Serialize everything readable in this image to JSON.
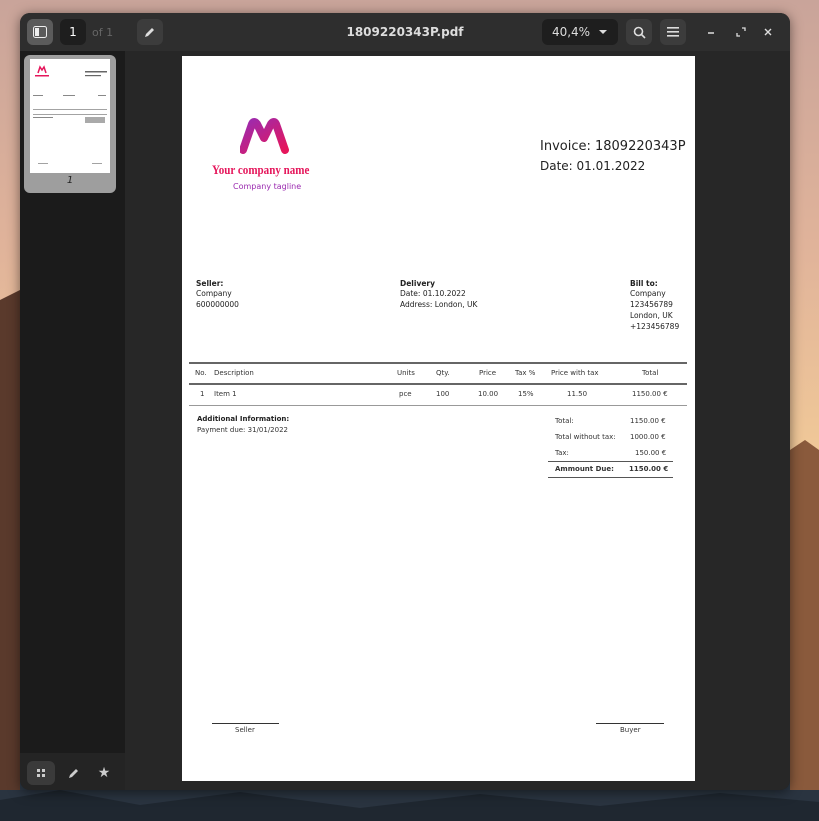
{
  "app": {
    "document_title": "1809220343P.pdf",
    "current_page": "1",
    "page_count_label": "of 1",
    "zoom": "40,4%",
    "thumbnail_page_label": "1"
  },
  "invoice": {
    "company_name": "Your company name",
    "company_tagline": "Company tagline",
    "invoice_title": "Invoice: 1809220343P",
    "date_title": "Date: 01.01.2022",
    "seller": {
      "heading": "Seller:",
      "lines": [
        "Company",
        "600000000"
      ]
    },
    "delivery": {
      "heading": "Delivery",
      "lines": [
        "Date: 01.10.2022",
        "Address: London, UK"
      ]
    },
    "bill_to": {
      "heading": "Bill to:",
      "lines": [
        "Company",
        "123456789",
        "London, UK",
        "+123456789"
      ]
    },
    "table": {
      "headers": [
        "No.",
        "Description",
        "Units",
        "Qty.",
        "Price",
        "Tax %",
        "Price with tax",
        "Total"
      ],
      "rows": [
        [
          "1",
          "Item 1",
          "pce",
          "100",
          "10.00",
          "15%",
          "11.50",
          "1150.00 €"
        ]
      ]
    },
    "additional_info_heading": "Additional Information:",
    "payment_due": "Payment due: 31/01/2022",
    "totals": [
      {
        "label": "Total:",
        "value": "1150.00 €"
      },
      {
        "label": "Total without tax:",
        "value": "1000.00 €"
      },
      {
        "label": "Tax:",
        "value": "150.00 €"
      }
    ],
    "amount_due_label": "Ammount Due:",
    "amount_due_value": "1150.00 €",
    "seller_signature_label": "Seller",
    "buyer_signature_label": "Buyer"
  },
  "colors": {
    "brand_red": "#e5165b",
    "brand_purple": "#9b2bb0"
  },
  "icons": {
    "sidebar_toggle": "sidebar-icon",
    "annotate": "pencil-icon",
    "search": "search-icon",
    "menu": "hamburger-icon",
    "minimize": "minimize-icon",
    "maximize": "maximize-icon",
    "close": "close-icon",
    "thumbnails": "grid-icon",
    "annotations": "pencil-icon",
    "bookmarks": "star-icon"
  }
}
